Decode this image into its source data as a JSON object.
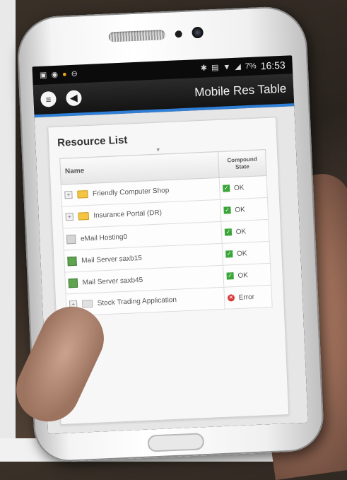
{
  "statusbar": {
    "time": "16:53",
    "battery": "7%"
  },
  "app": {
    "title": "Mobile Res Table"
  },
  "panel": {
    "title": "Resource List"
  },
  "table": {
    "col_name": "Name",
    "col_state_line1": "Compound",
    "col_state_line2": "State",
    "rows": [
      {
        "name": "Friendly Computer Shop",
        "state": "OK"
      },
      {
        "name": "Insurance Portal (DR)",
        "state": "OK"
      },
      {
        "name": "eMail Hosting0",
        "state": "OK"
      },
      {
        "name": "Mail Server saxb15",
        "state": "OK"
      },
      {
        "name": "Mail Server saxb45",
        "state": "OK"
      },
      {
        "name": "Stock Trading Application",
        "state": "Error"
      }
    ]
  },
  "colors": {
    "accent": "#2f7fd6",
    "ok": "#3aa63a",
    "error": "#d93636"
  }
}
